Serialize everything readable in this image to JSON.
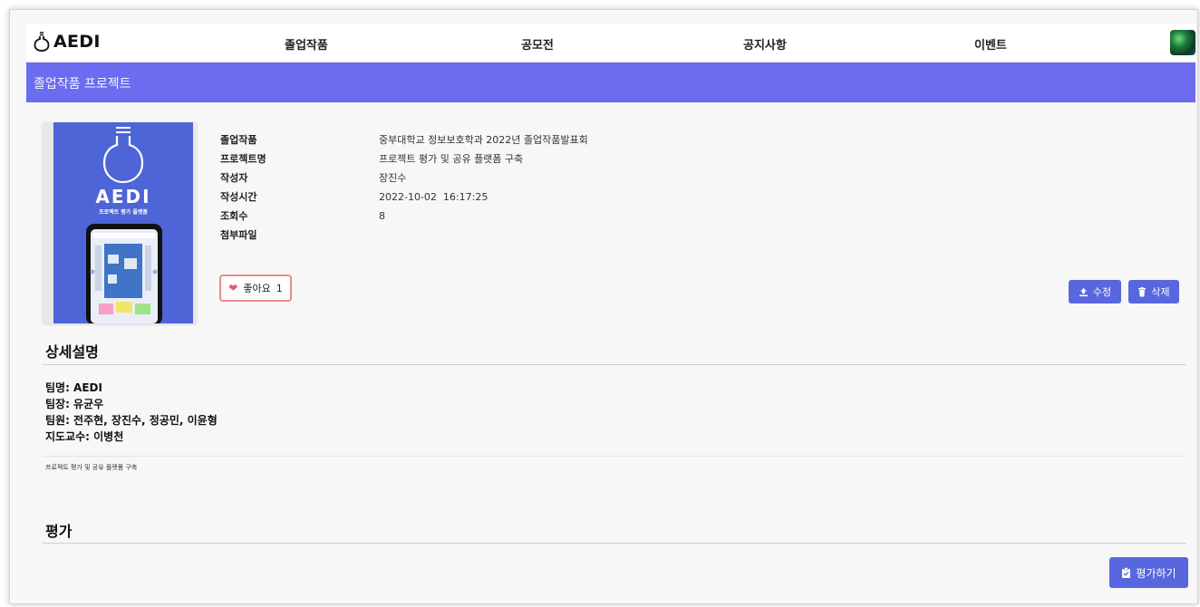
{
  "header": {
    "logo_text": "AEDI",
    "nav": [
      "졸업작품",
      "공모전",
      "공지사항",
      "이벤트"
    ]
  },
  "banner": {
    "title": "졸업작품 프로젝트"
  },
  "project": {
    "thumbnail": {
      "brand": "AEDI",
      "subtitle": "프로젝트 평가 플랫폼"
    },
    "meta": [
      {
        "label": "졸업작품",
        "value": "중부대학교 정보보호학과 2022년 졸업작품발표회"
      },
      {
        "label": "프로젝트명",
        "value": "프로젝트 평가 및 공유 플랫폼 구축"
      },
      {
        "label": "작성자",
        "value": "장진수"
      },
      {
        "label": "작성시간",
        "value": "2022-10-02  16:17:25"
      },
      {
        "label": "조회수",
        "value": "8"
      },
      {
        "label": "첨부파일",
        "value": ""
      }
    ],
    "like": {
      "label": "좋아요",
      "count": "1"
    },
    "actions": {
      "edit": "수정",
      "delete": "삭제"
    }
  },
  "details": {
    "heading": "상세설명",
    "team_lines": [
      "팀명: AEDI",
      "팀장: 유균우",
      "팀원: 전주현, 장진수, 정공민, 이윤형",
      "지도교수: 이병천"
    ],
    "description": "프로젝트 평가 및 공유 플랫폼 구축"
  },
  "evaluation": {
    "heading": "평가",
    "button": "평가하기"
  },
  "colors": {
    "banner": "#6c6cf0",
    "button": "#5867de",
    "like_border": "#ea8a8a"
  }
}
